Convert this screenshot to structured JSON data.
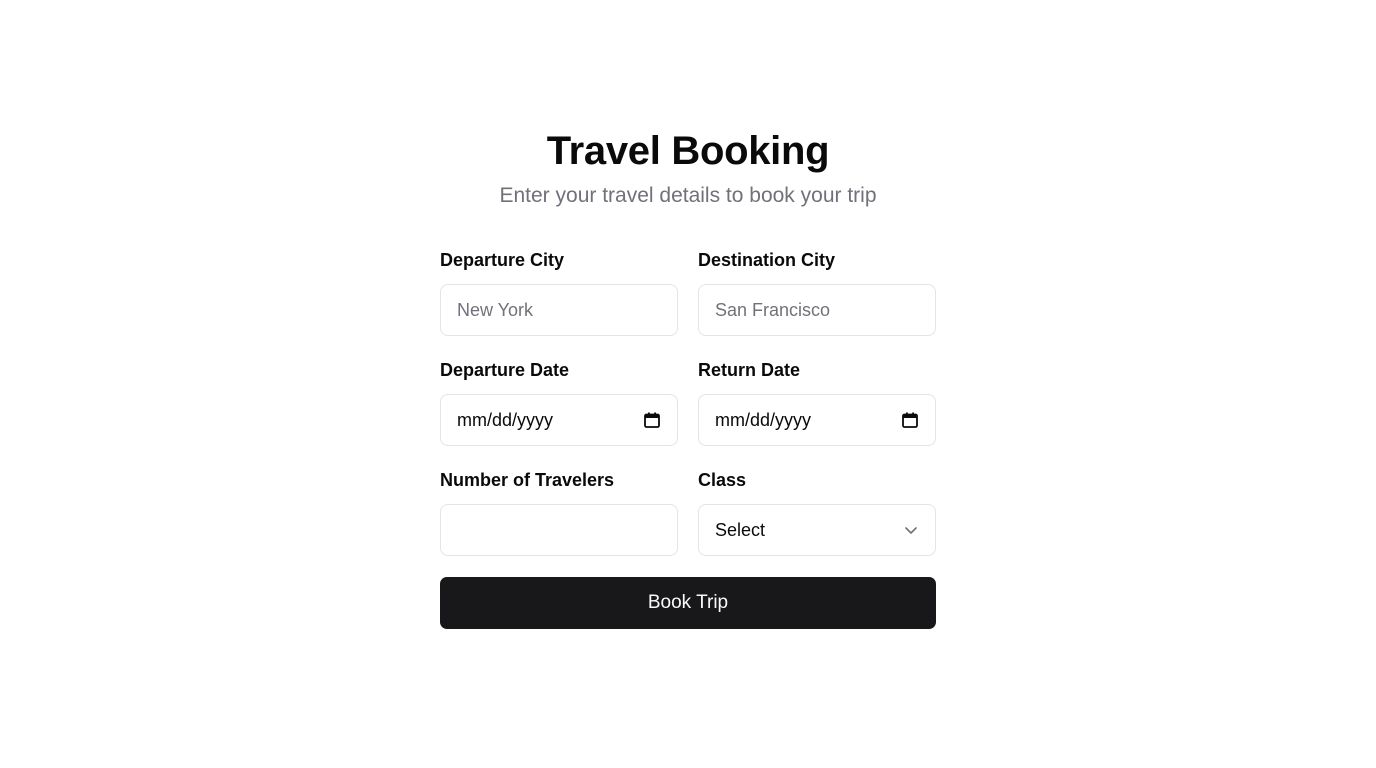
{
  "header": {
    "title": "Travel Booking",
    "subtitle": "Enter your travel details to book your trip"
  },
  "form": {
    "departure_city": {
      "label": "Departure City",
      "placeholder": "New York",
      "value": ""
    },
    "destination_city": {
      "label": "Destination City",
      "placeholder": "San Francisco",
      "value": ""
    },
    "departure_date": {
      "label": "Departure Date",
      "placeholder": "mm/dd/yyyy",
      "icon": "calendar-icon"
    },
    "return_date": {
      "label": "Return Date",
      "placeholder": "mm/dd/yyyy",
      "icon": "calendar-icon"
    },
    "travelers": {
      "label": "Number of Travelers",
      "value": ""
    },
    "class": {
      "label": "Class",
      "selected": "Select",
      "icon": "chevron-down-icon"
    },
    "submit_label": "Book Trip"
  },
  "colors": {
    "primary_button": "#18181b",
    "muted_text": "#71717a",
    "border": "#e4e4e7"
  }
}
